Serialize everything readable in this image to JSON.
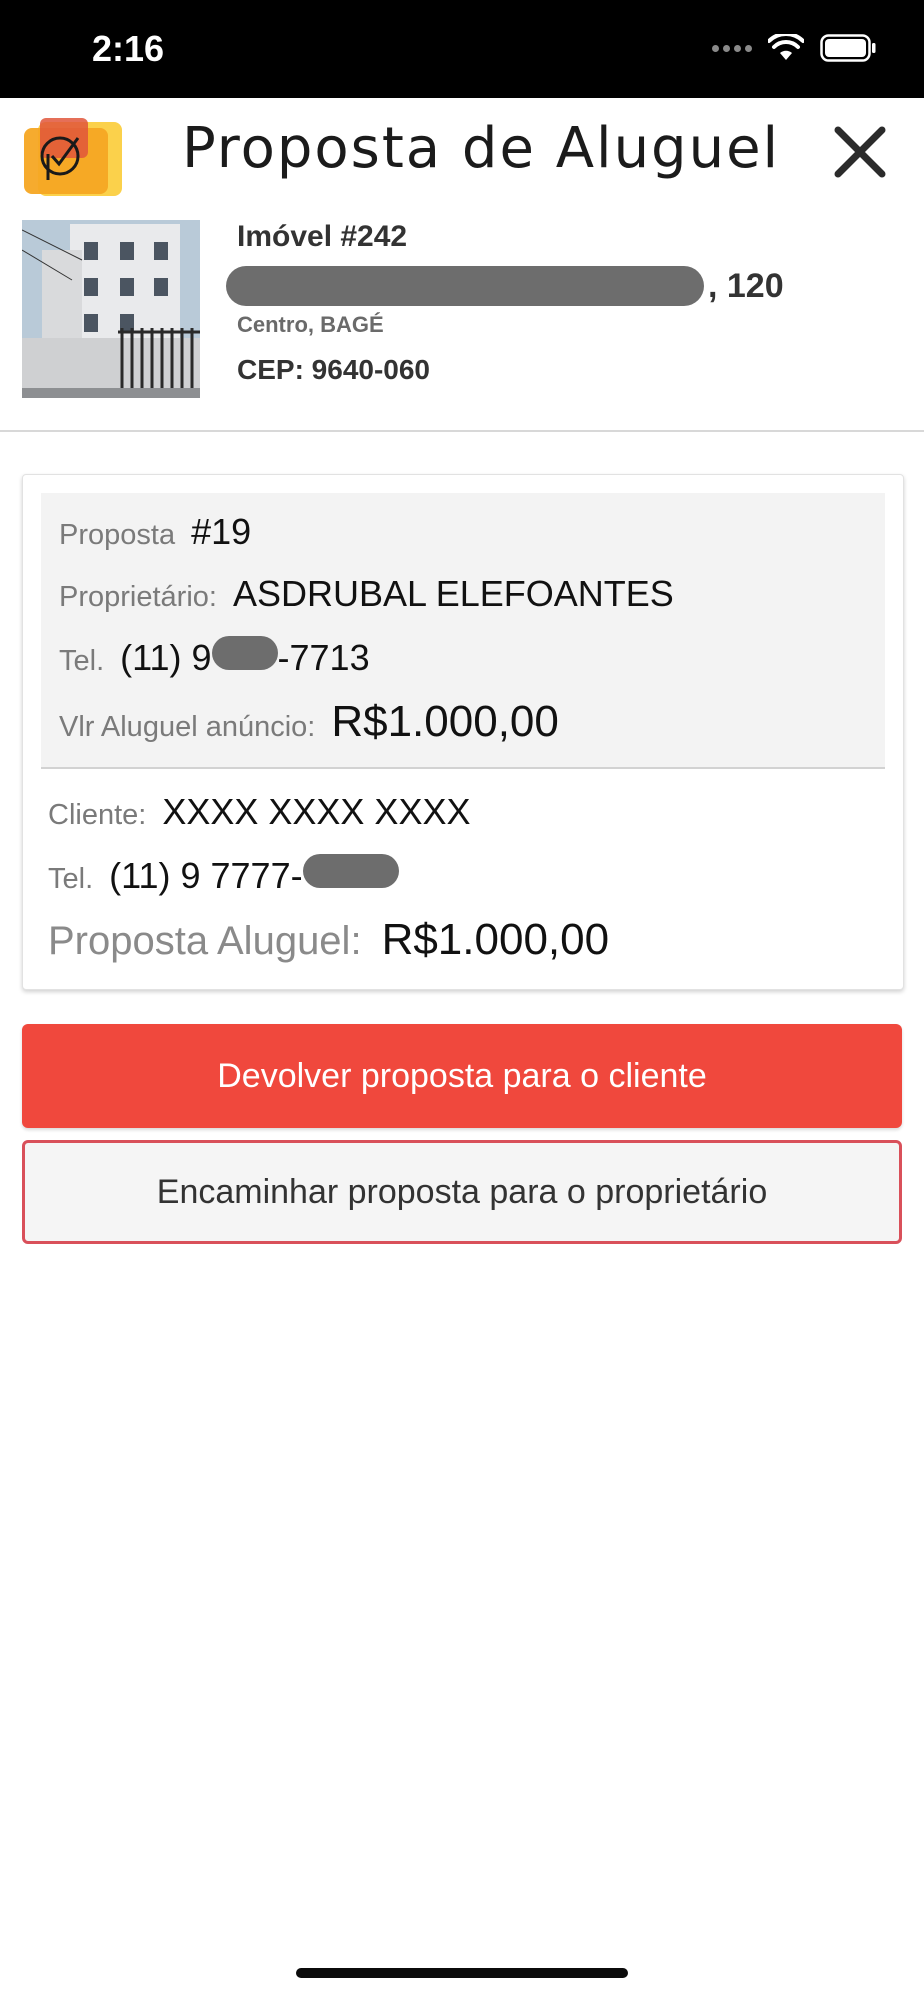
{
  "status_bar": {
    "time": "2:16"
  },
  "header": {
    "title": "Proposta de Aluguel"
  },
  "property": {
    "id_label": "Imóvel #242",
    "street_number": ", 120",
    "district": "Centro, BAGÉ",
    "cep": "CEP: 9640-060"
  },
  "proposal": {
    "number_label": "Proposta",
    "number": "#19",
    "owner_label": "Proprietário:",
    "owner_name": "ASDRUBAL ELEFOANTES",
    "owner_tel_label": "Tel.",
    "owner_tel_prefix": "(11) 9",
    "owner_tel_suffix": "-7713",
    "listed_rent_label": "Vlr Aluguel anúncio:",
    "listed_rent": "R$1.000,00",
    "client_label": "Cliente:",
    "client_name": "XXXX XXXX XXXX",
    "client_tel_label": "Tel.",
    "client_tel_prefix": "(11) 9 7777-",
    "proposed_rent_label": "Proposta Aluguel:",
    "proposed_rent": "R$1.000,00"
  },
  "actions": {
    "return_label": "Devolver proposta para o cliente",
    "forward_label": "Encaminhar proposta para o proprietário"
  },
  "colors": {
    "accent_red": "#f0483d",
    "outline_red": "#d9505a",
    "logo_orange": "#f5a623",
    "logo_yellow": "#fbd14b"
  }
}
